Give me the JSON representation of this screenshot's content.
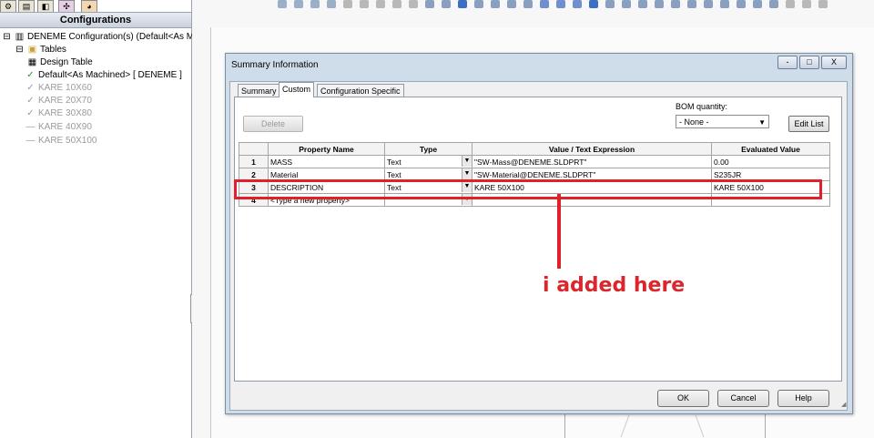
{
  "left_panel": {
    "title": "Configurations",
    "tree": [
      {
        "label": "DENEME Configuration(s)  (Default<As Ma",
        "icon": "part-icon",
        "expand": "⊟",
        "muted": false
      },
      {
        "label": "Tables",
        "icon": "folder-icon",
        "expand": "⊟",
        "muted": false
      },
      {
        "label": "Design Table",
        "icon": "design-table-icon",
        "expand": "",
        "muted": false
      },
      {
        "label": "Default<As Machined> [ DENEME ]",
        "icon": "check-icon",
        "expand": "",
        "muted": false
      },
      {
        "label": "KARE 10X60",
        "icon": "check-icon",
        "expand": "",
        "muted": true
      },
      {
        "label": "KARE 20X70",
        "icon": "check-icon",
        "expand": "",
        "muted": true
      },
      {
        "label": "KARE 30X80",
        "icon": "check-icon",
        "expand": "",
        "muted": true
      },
      {
        "label": "KARE 40X90",
        "icon": "dash-icon",
        "expand": "",
        "muted": true
      },
      {
        "label": "KARE 50X100",
        "icon": "dash-icon",
        "expand": "",
        "muted": true
      }
    ]
  },
  "dialog": {
    "title": "Summary Information",
    "window_buttons": [
      "-",
      "□",
      "X"
    ],
    "tabs": [
      "Summary",
      "Custom",
      "Configuration Specific"
    ],
    "active_tab": "Custom",
    "delete_label": "Delete",
    "bom_label": "BOM quantity:",
    "bom_value": "- None -",
    "edit_list_label": "Edit List",
    "columns": [
      "",
      "Property Name",
      "Type",
      "Value / Text Expression",
      "Evaluated Value"
    ],
    "rows": [
      {
        "num": "1",
        "name": "MASS",
        "type": "Text",
        "value": "\"SW-Mass@DENEME.SLDPRT\"",
        "evaluated": "0.00"
      },
      {
        "num": "2",
        "name": "Material",
        "type": "Text",
        "value": "\"SW-Material@DENEME.SLDPRT\"",
        "evaluated": "S235JR"
      },
      {
        "num": "3",
        "name": "DESCRIPTION",
        "type": "Text",
        "value": "KARE 50X100",
        "evaluated": "KARE 50X100"
      },
      {
        "num": "4",
        "name": "<Type a new property>",
        "type": "",
        "value": "",
        "evaluated": ""
      }
    ],
    "ok_label": "OK",
    "cancel_label": "Cancel",
    "help_label": "Help"
  },
  "annotation": {
    "text": "i added here",
    "color": "#e0202a"
  }
}
